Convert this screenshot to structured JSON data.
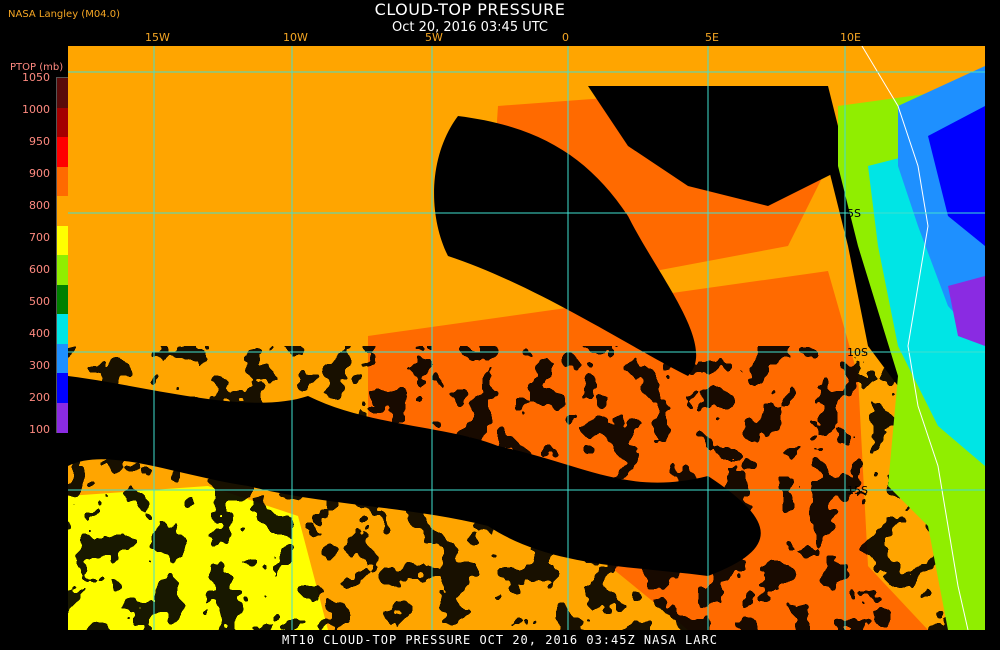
{
  "header": {
    "title": "CLOUD-TOP PRESSURE",
    "subtitle": "Oct 20, 2016 03:45 UTC",
    "credit": "NASA Langley (M04.0)"
  },
  "colorbar": {
    "title": "PTOP (mb)",
    "labels": [
      "1050",
      "1000",
      "950",
      "900",
      "800",
      "700",
      "600",
      "500",
      "400",
      "300",
      "200",
      "100"
    ],
    "colors": [
      "#5a0a0a",
      "#a40000",
      "#ff0000",
      "#ff6a00",
      "#ffa500",
      "#ffff00",
      "#90ee00",
      "#008000",
      "#00e5e5",
      "#1e90ff",
      "#0000ff",
      "#8a2be2"
    ]
  },
  "map": {
    "lon_labels": [
      "15W",
      "10W",
      "5W",
      "0",
      "5E",
      "10E"
    ],
    "lat_labels": [
      "5S",
      "10S",
      "15S"
    ],
    "grid_color": "#40e0d0"
  },
  "footer": "MT10  CLOUD-TOP PRESSURE  OCT 20, 2016 03:45Z  NASA LARC"
}
